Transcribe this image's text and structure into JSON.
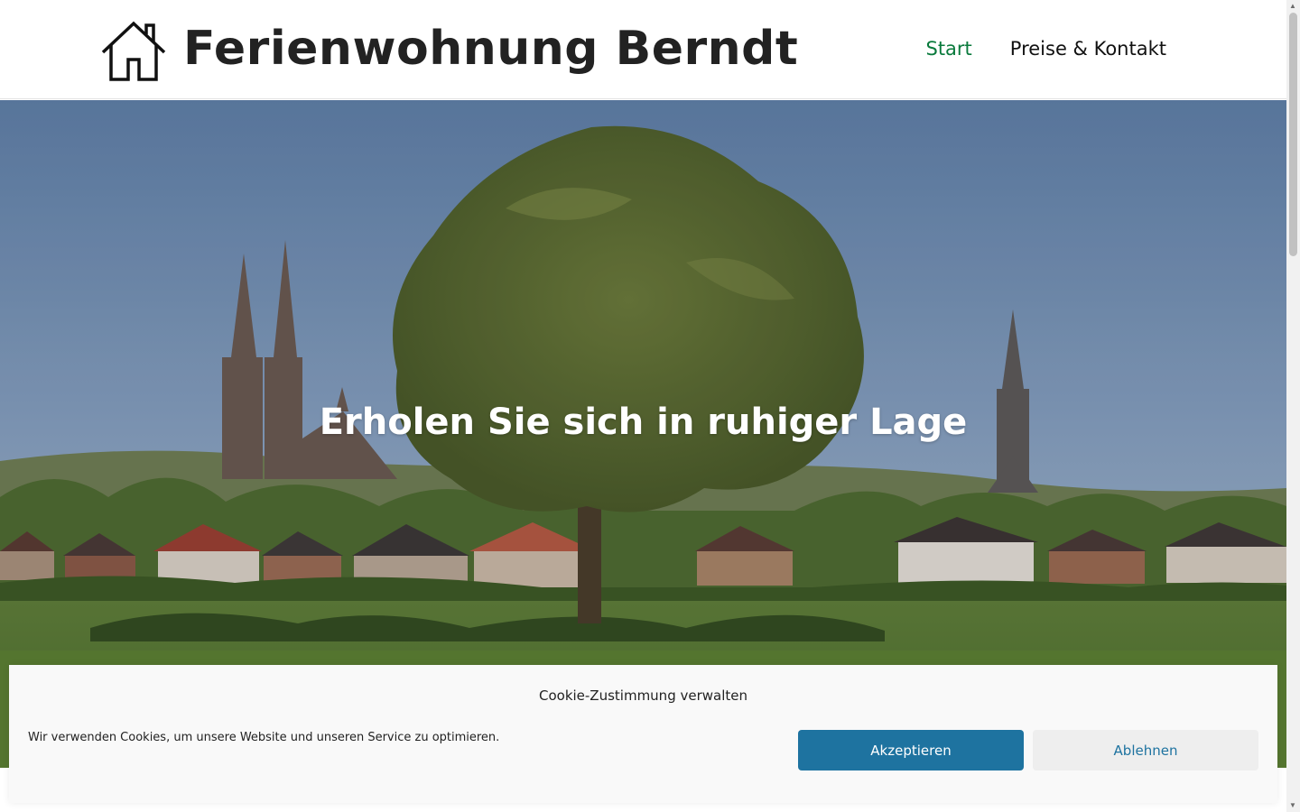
{
  "header": {
    "site_title": "Ferienwohnung Berndt",
    "logo_icon": "house-icon",
    "nav": [
      {
        "label": "Start",
        "active": true
      },
      {
        "label": "Preise & Kontakt",
        "active": false
      }
    ]
  },
  "hero": {
    "title": "Erholen Sie sich in ruhiger Lage"
  },
  "cookie_banner": {
    "title": "Cookie-Zustimmung verwalten",
    "text": "Wir verwenden Cookies, um unsere Website und unseren Service zu optimieren.",
    "accept_label": "Akzeptieren",
    "decline_label": "Ablehnen"
  },
  "colors": {
    "nav_active": "#0a7a3c",
    "accept_button": "#1e73a0",
    "decline_text": "#1e73a0"
  }
}
